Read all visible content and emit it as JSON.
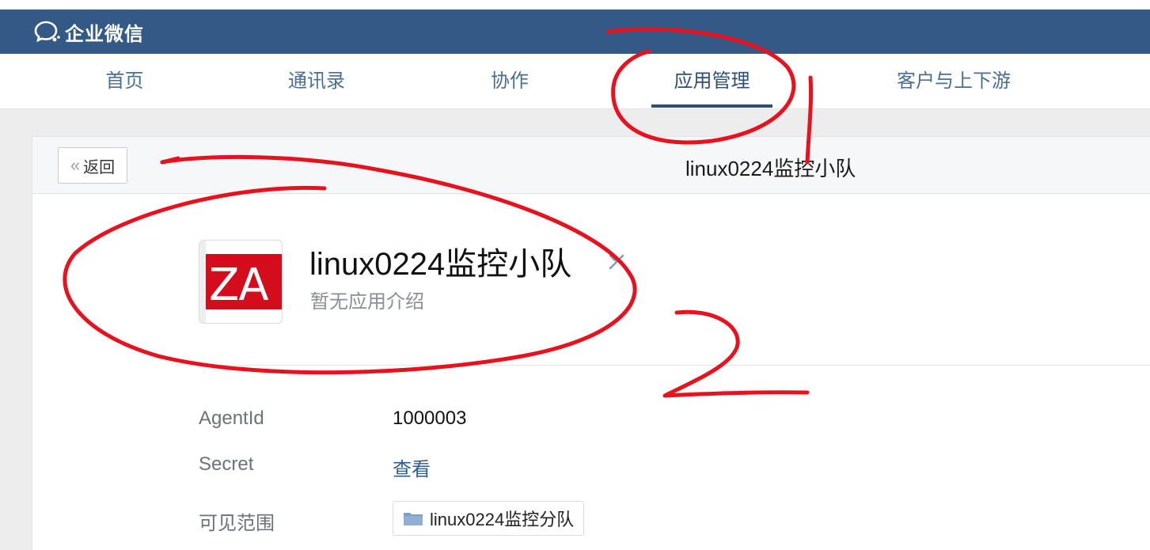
{
  "brand": {
    "name": "企业微信",
    "bar_color": "#335a87"
  },
  "nav": {
    "items": [
      {
        "label": "首页"
      },
      {
        "label": "通讯录"
      },
      {
        "label": "协作"
      },
      {
        "label": "应用管理",
        "active": true
      },
      {
        "label": "客户与上下游"
      }
    ]
  },
  "panel": {
    "back_label": "返回",
    "title": "linux0224监控小队"
  },
  "app": {
    "logo_text": "ZA",
    "name": "linux0224监控小队",
    "intro": "暂无应用介绍",
    "logo_color": "#d30d1c"
  },
  "details": {
    "agentid_label": "AgentId",
    "agentid_value": "1000003",
    "secret_label": "Secret",
    "secret_link": "查看",
    "scope_label": "可见范围",
    "scope_value": "linux0224监控分队"
  },
  "annotations": {
    "color": "#e8121f",
    "number_one": "1",
    "number_two": "2"
  }
}
